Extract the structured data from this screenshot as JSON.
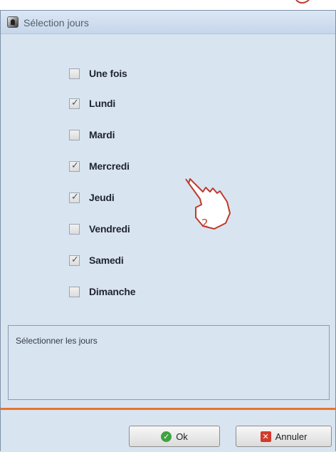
{
  "window": {
    "title": "Sélection jours"
  },
  "days": [
    {
      "label": "Une fois",
      "checked": false
    },
    {
      "label": "Lundi",
      "checked": true
    },
    {
      "label": "Mardi",
      "checked": false
    },
    {
      "label": "Mercredi",
      "checked": true
    },
    {
      "label": "Jeudi",
      "checked": true
    },
    {
      "label": "Vendredi",
      "checked": false
    },
    {
      "label": "Samedi",
      "checked": true
    },
    {
      "label": "Dimanche",
      "checked": false
    }
  ],
  "hint": {
    "text": "Sélectionner les jours"
  },
  "buttons": {
    "ok_label": "Ok",
    "cancel_label": "Annuler"
  },
  "annotation": {
    "number": "2"
  },
  "colors": {
    "window_bg": "#d9e4f1",
    "separator": "#e8742a",
    "annotation": "#c0392b"
  }
}
